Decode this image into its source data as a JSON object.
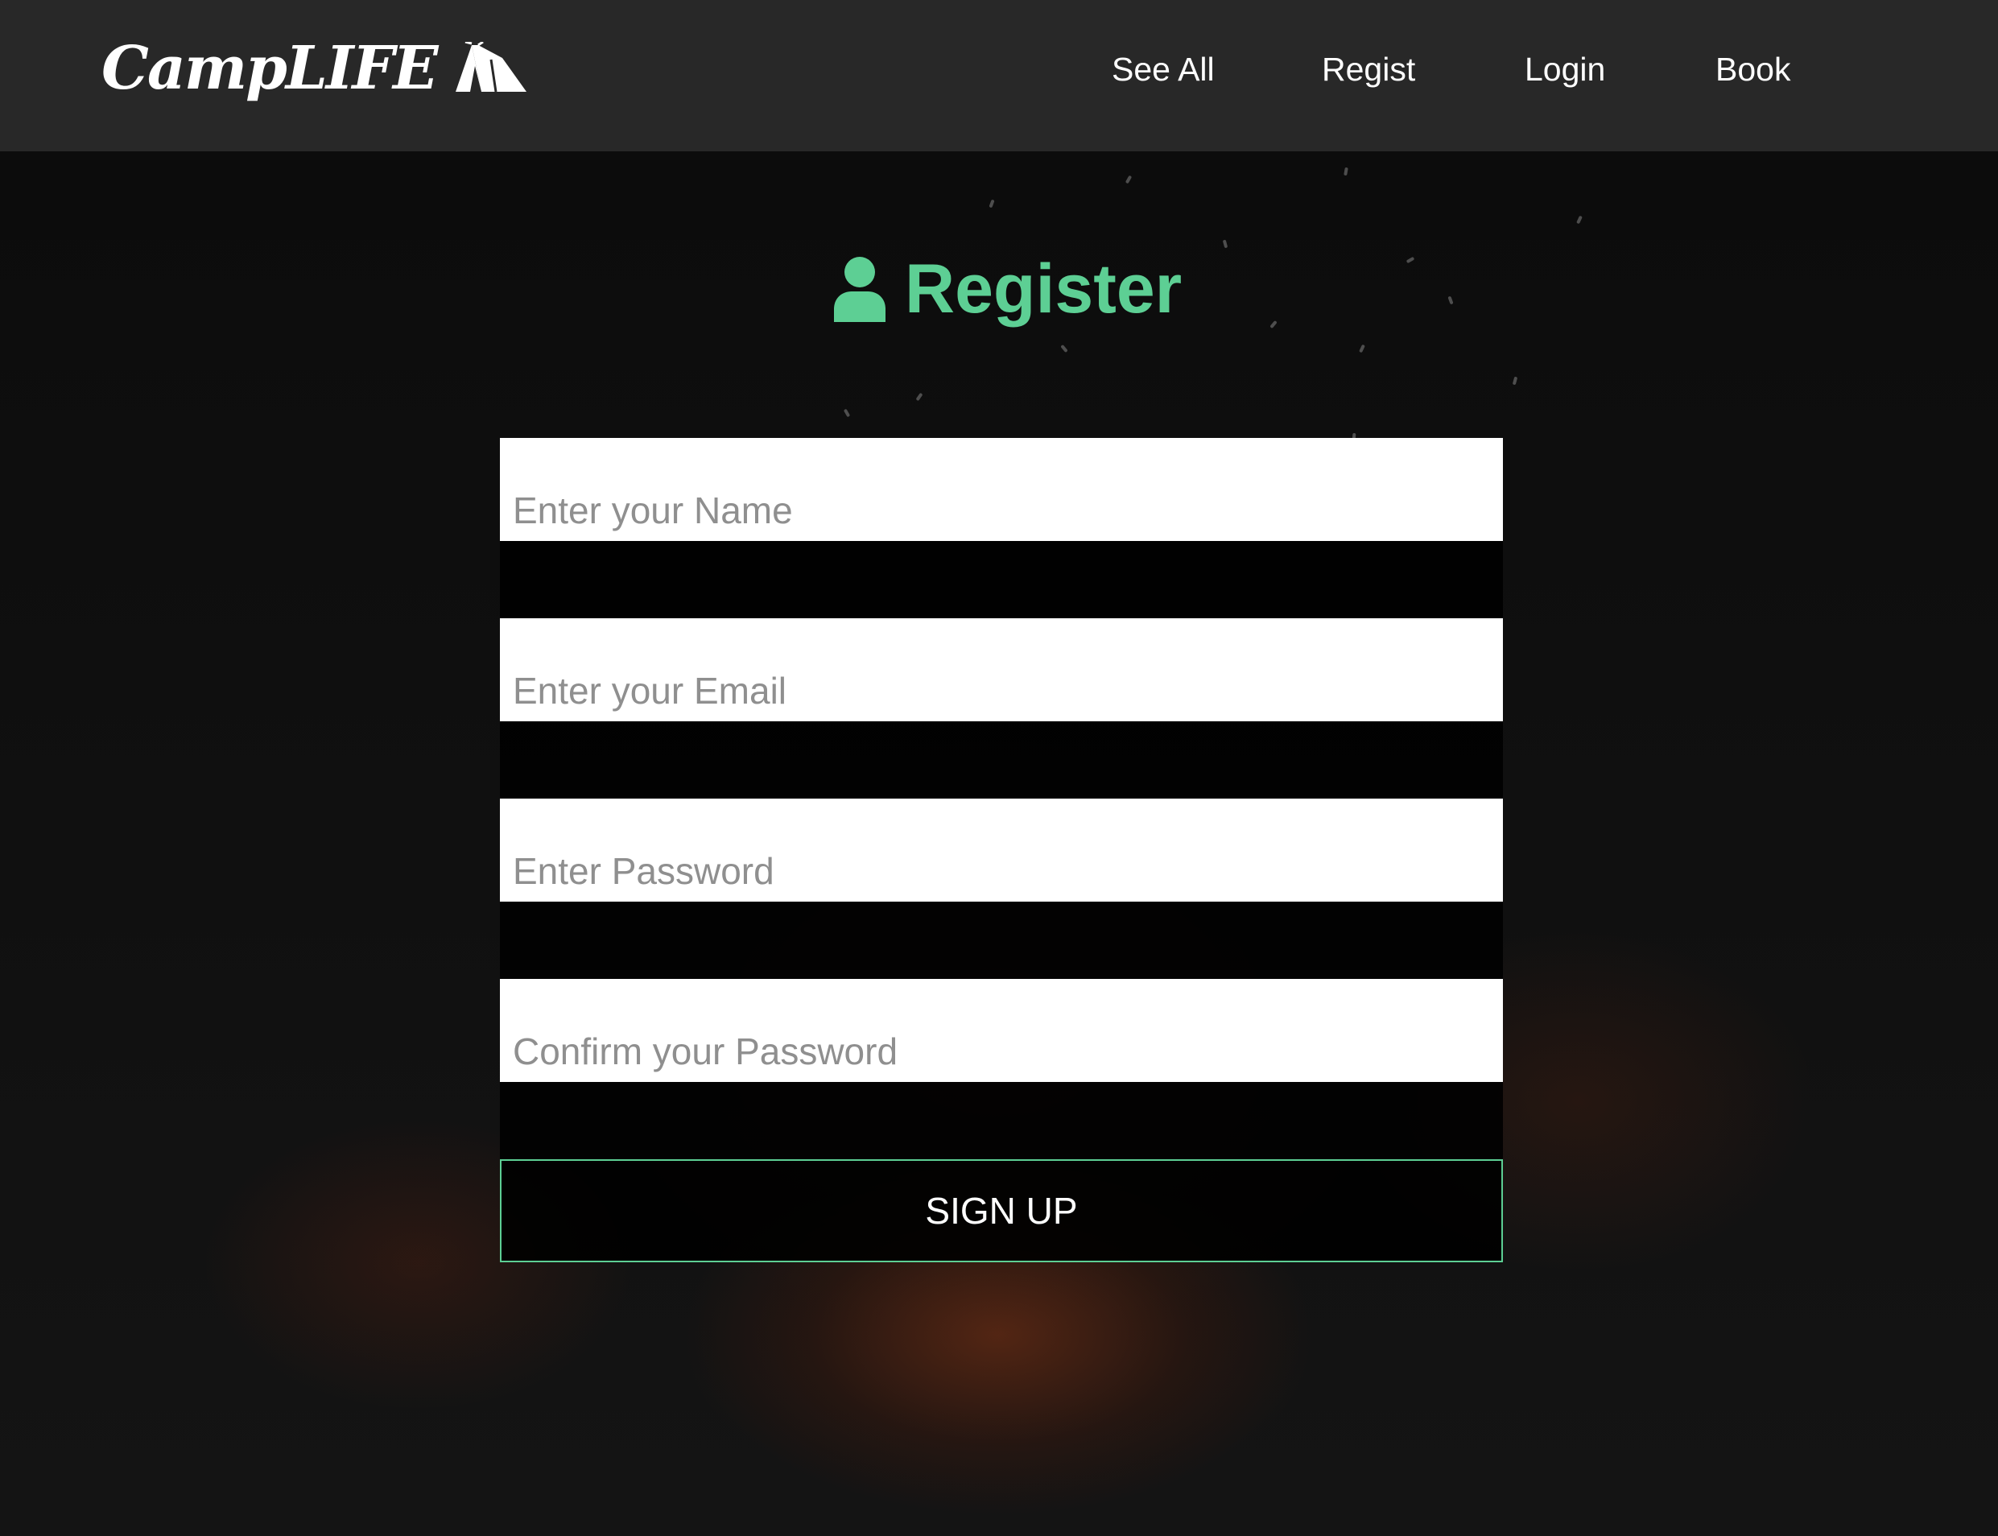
{
  "header": {
    "brand": "CampLIFE",
    "brand_icon": "tent-icon",
    "nav": [
      {
        "label": "See All"
      },
      {
        "label": "Regist"
      },
      {
        "label": "Login"
      },
      {
        "label": "Book"
      }
    ]
  },
  "register": {
    "title": "Register",
    "title_icon": "user-icon",
    "accent_color": "#5dcf94",
    "fields": [
      {
        "placeholder": "Enter your Name",
        "value": ""
      },
      {
        "placeholder": "Enter your Email",
        "value": ""
      },
      {
        "placeholder": "Enter Password",
        "value": ""
      },
      {
        "placeholder": "Confirm your Password",
        "value": ""
      }
    ],
    "submit_label": "SIGN UP"
  }
}
